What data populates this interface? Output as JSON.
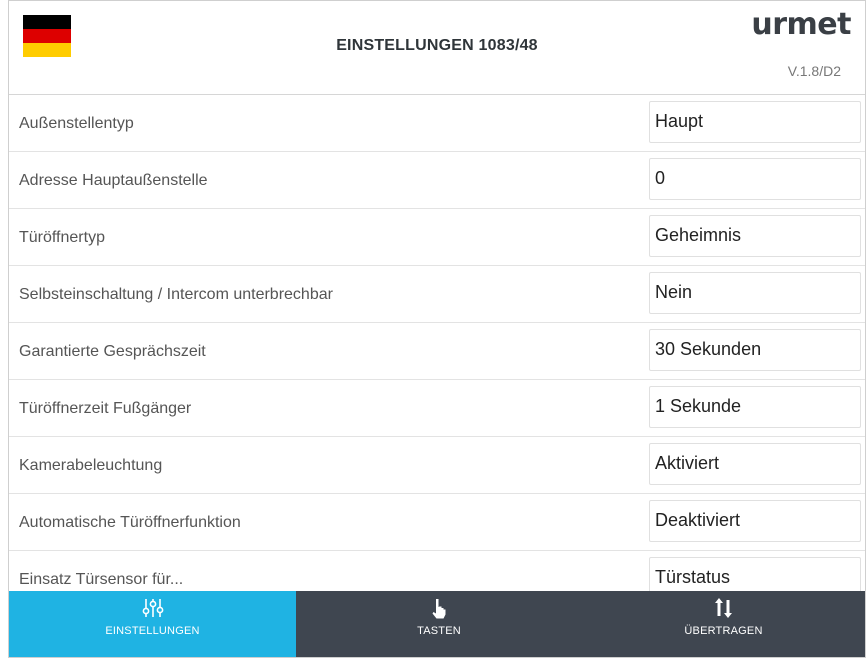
{
  "header": {
    "title": "EINSTELLUNGEN 1083/48",
    "logo": "urmet",
    "version": "V.1.8/D2",
    "flag_colors": [
      "#000000",
      "#dd0000",
      "#ffcc00"
    ]
  },
  "settings": [
    {
      "label": "Außenstellentyp",
      "value": "Haupt"
    },
    {
      "label": "Adresse Hauptaußenstelle",
      "value": "0"
    },
    {
      "label": "Türöffnertyp",
      "value": "Geheimnis"
    },
    {
      "label": "Selbsteinschaltung / Intercom unterbrechbar",
      "value": "Nein"
    },
    {
      "label": "Garantierte Gesprächszeit",
      "value": "30 Sekunden"
    },
    {
      "label": "Türöffnerzeit Fußgänger",
      "value": "1 Sekunde"
    },
    {
      "label": "Kamerabeleuchtung",
      "value": "Aktiviert"
    },
    {
      "label": "Automatische Türöffnerfunktion",
      "value": "Deaktiviert"
    },
    {
      "label": "Einsatz Türsensor für...",
      "value": "Türstatus"
    }
  ],
  "tabs": [
    {
      "label": "EINSTELLUNGEN",
      "icon": "sliders-icon",
      "active": true
    },
    {
      "label": "TASTEN",
      "icon": "hand-pointer-icon",
      "active": false
    },
    {
      "label": "ÜBERTRAGEN",
      "icon": "transfer-arrows-icon",
      "active": false
    }
  ],
  "colors": {
    "active_tab": "#1fb3e3",
    "tabbar": "#3f4650"
  }
}
